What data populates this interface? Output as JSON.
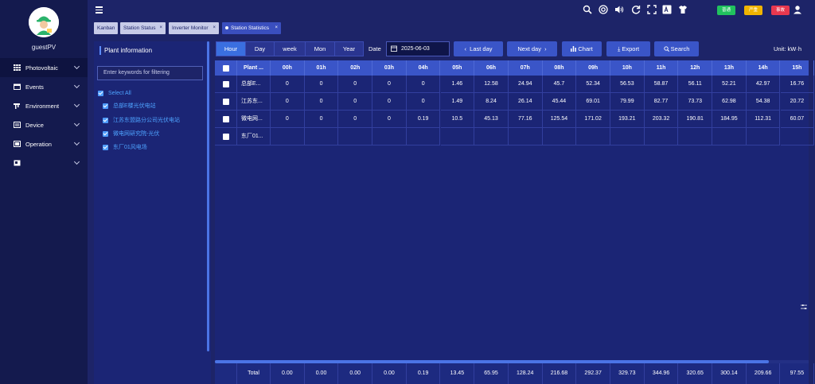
{
  "user": {
    "name": "guestPV"
  },
  "sidebar": {
    "items": [
      {
        "label": "Photovoltaic",
        "icon": "grid-icon"
      },
      {
        "label": "Events",
        "icon": "calendar-icon"
      },
      {
        "label": "Environment",
        "icon": "weather-icon"
      },
      {
        "label": "Device",
        "icon": "device-icon"
      },
      {
        "label": "Operation",
        "icon": "operation-icon"
      },
      {
        "label": "",
        "icon": "report-icon"
      }
    ]
  },
  "topbar": {
    "badges": [
      {
        "label": "普通",
        "color": "#21c25e"
      },
      {
        "label": "严重",
        "color": "#f0b400"
      },
      {
        "label": "事故",
        "color": "#e8384f"
      }
    ]
  },
  "tabs": [
    {
      "label": "Kanban",
      "closable": false
    },
    {
      "label": "Station Status",
      "closable": true
    },
    {
      "label": "Inverter Monitor",
      "closable": true
    },
    {
      "label": "Station Statistics",
      "closable": true,
      "active": true
    }
  ],
  "panel": {
    "title": "Plant information",
    "filter_placeholder": "Enter keywords for filtering",
    "select_all": "Select All",
    "plants": [
      "总部E楼光伏电站",
      "江苏东盟路分公司光伏电站",
      "微电网研究院-光伏",
      "东厂01风电场"
    ]
  },
  "toolbar": {
    "periods": [
      "Hour",
      "Day",
      "week",
      "Mon",
      "Year"
    ],
    "active_period": "Hour",
    "date_label": "Date",
    "date_value": "2025-06-03",
    "last_day": "Last day",
    "next_day": "Next day",
    "chart": "Chart",
    "export": "Export",
    "search": "Search",
    "unit": "Unit:  kW·h"
  },
  "table": {
    "columns": [
      "Plant ...",
      "00h",
      "01h",
      "02h",
      "03h",
      "04h",
      "05h",
      "06h",
      "07h",
      "08h",
      "09h",
      "10h",
      "11h",
      "12h",
      "13h",
      "14h",
      "15h"
    ],
    "rows": [
      {
        "name": "总部E...",
        "values": [
          "0",
          "0",
          "0",
          "0",
          "0",
          "1.46",
          "12.58",
          "24.94",
          "45.7",
          "52.34",
          "56.53",
          "58.87",
          "56.11",
          "52.21",
          "42.97",
          "16.76"
        ]
      },
      {
        "name": "江苏东...",
        "values": [
          "0",
          "0",
          "0",
          "0",
          "0",
          "1.49",
          "8.24",
          "26.14",
          "45.44",
          "69.01",
          "79.99",
          "82.77",
          "73.73",
          "62.98",
          "54.38",
          "20.72"
        ]
      },
      {
        "name": "微电网...",
        "values": [
          "0",
          "0",
          "0",
          "0",
          "0.19",
          "10.5",
          "45.13",
          "77.16",
          "125.54",
          "171.02",
          "193.21",
          "203.32",
          "190.81",
          "184.95",
          "112.31",
          "60.07"
        ]
      },
      {
        "name": "东厂01...",
        "values": [
          "",
          "",
          "",
          "",
          "",
          "",
          "",
          "",
          "",
          "",
          "",
          "",
          "",
          "",
          "",
          ""
        ]
      }
    ],
    "total_label": "Total",
    "totals": [
      "0.00",
      "0.00",
      "0.00",
      "0.00",
      "0.19",
      "13.45",
      "65.95",
      "128.24",
      "216.68",
      "292.37",
      "329.73",
      "344.96",
      "320.65",
      "300.14",
      "209.66",
      "97.55"
    ]
  }
}
